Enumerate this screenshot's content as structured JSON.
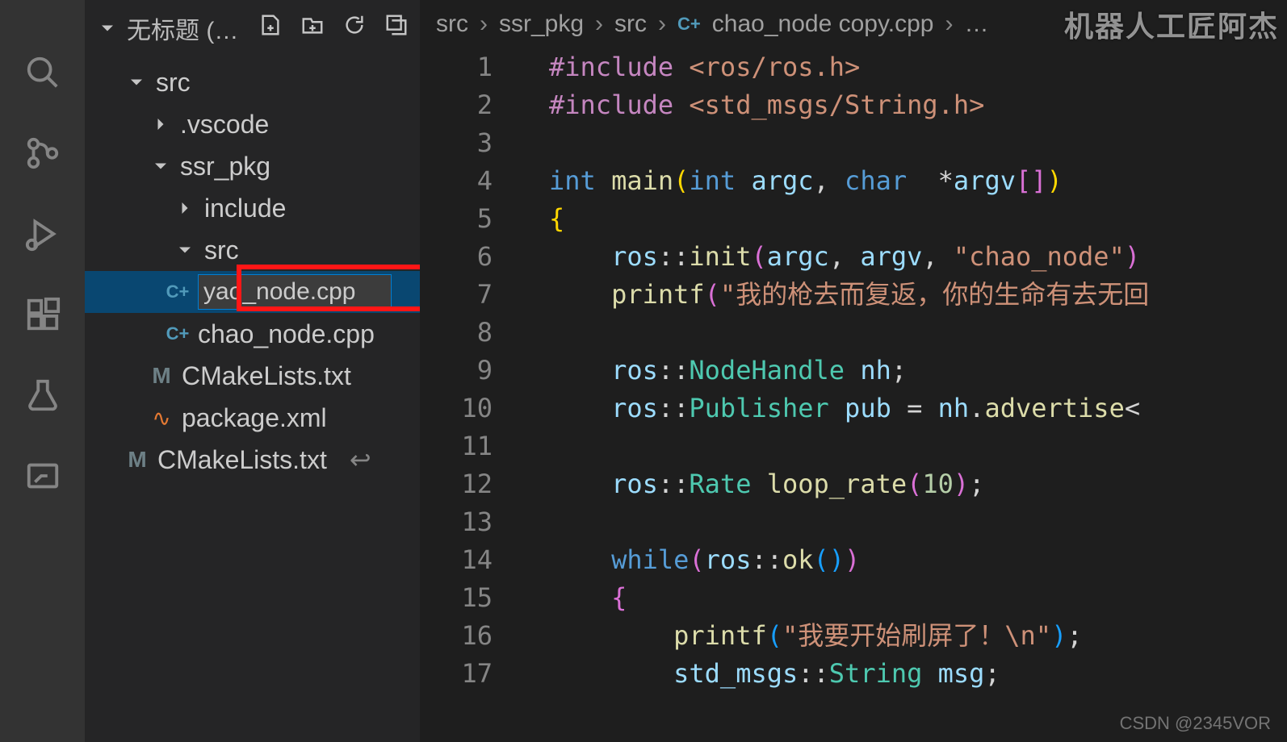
{
  "sidebar": {
    "title": "无标题 (…",
    "tree": {
      "root": "src",
      "items": [
        {
          "label": ".vscode",
          "type": "folder",
          "expanded": false,
          "depth": 1
        },
        {
          "label": "ssr_pkg",
          "type": "folder",
          "expanded": true,
          "depth": 1
        },
        {
          "label": "include",
          "type": "folder",
          "expanded": false,
          "depth": 2
        },
        {
          "label": "src",
          "type": "folder",
          "expanded": true,
          "depth": 2
        },
        {
          "label": "yao_node.cpp",
          "type": "file",
          "icon": "cpp",
          "depth": 3,
          "renaming": true
        },
        {
          "label": "chao_node.cpp",
          "type": "file",
          "icon": "cpp",
          "depth": 3
        },
        {
          "label": "CMakeLists.txt",
          "type": "file",
          "icon": "m",
          "depth": 2
        },
        {
          "label": "package.xml",
          "type": "file",
          "icon": "xml",
          "depth": 2
        },
        {
          "label": "CMakeLists.txt",
          "type": "file",
          "icon": "m",
          "depth": 1,
          "linked": true
        }
      ]
    }
  },
  "breadcrumbs": [
    "src",
    "ssr_pkg",
    "src",
    "chao_node copy.cpp",
    "…"
  ],
  "code": {
    "lines": [
      [
        [
          "pp",
          "#include"
        ],
        [
          "pun",
          " "
        ],
        [
          "inc",
          "<ros/ros.h>"
        ]
      ],
      [
        [
          "pp",
          "#include"
        ],
        [
          "pun",
          " "
        ],
        [
          "inc",
          "<std_msgs/String.h>"
        ]
      ],
      [],
      [
        [
          "kw",
          "int"
        ],
        [
          "pun",
          " "
        ],
        [
          "fn",
          "main"
        ],
        [
          "br1",
          "("
        ],
        [
          "kw",
          "int"
        ],
        [
          "pun",
          " "
        ],
        [
          "var",
          "argc"
        ],
        [
          "pun",
          ", "
        ],
        [
          "kw",
          "char"
        ],
        [
          "pun",
          "  *"
        ],
        [
          "var",
          "argv"
        ],
        [
          "br2",
          "["
        ],
        [
          "br2",
          "]"
        ],
        [
          "br1",
          ")"
        ]
      ],
      [
        [
          "br1",
          "{"
        ]
      ],
      [
        [
          "pun",
          "    "
        ],
        [
          "var",
          "ros"
        ],
        [
          "pun",
          "::"
        ],
        [
          "fn",
          "init"
        ],
        [
          "br2",
          "("
        ],
        [
          "var",
          "argc"
        ],
        [
          "pun",
          ", "
        ],
        [
          "var",
          "argv"
        ],
        [
          "pun",
          ", "
        ],
        [
          "str",
          "\"chao_node\""
        ],
        [
          "br2",
          ")"
        ]
      ],
      [
        [
          "pun",
          "    "
        ],
        [
          "fn",
          "printf"
        ],
        [
          "br2",
          "("
        ],
        [
          "str",
          "\"我的枪去而复返，你的生命有去无回"
        ]
      ],
      [],
      [
        [
          "pun",
          "    "
        ],
        [
          "var",
          "ros"
        ],
        [
          "pun",
          "::"
        ],
        [
          "type",
          "NodeHandle"
        ],
        [
          "pun",
          " "
        ],
        [
          "var",
          "nh"
        ],
        [
          "pun",
          ";"
        ]
      ],
      [
        [
          "pun",
          "    "
        ],
        [
          "var",
          "ros"
        ],
        [
          "pun",
          "::"
        ],
        [
          "type",
          "Publisher"
        ],
        [
          "pun",
          " "
        ],
        [
          "var",
          "pub"
        ],
        [
          "pun",
          " = "
        ],
        [
          "var",
          "nh"
        ],
        [
          "pun",
          "."
        ],
        [
          "fn",
          "advertise"
        ],
        [
          "pun",
          "<"
        ]
      ],
      [],
      [
        [
          "pun",
          "    "
        ],
        [
          "var",
          "ros"
        ],
        [
          "pun",
          "::"
        ],
        [
          "type",
          "Rate"
        ],
        [
          "pun",
          " "
        ],
        [
          "fn",
          "loop_rate"
        ],
        [
          "br2",
          "("
        ],
        [
          "num",
          "10"
        ],
        [
          "br2",
          ")"
        ],
        [
          "pun",
          ";"
        ]
      ],
      [],
      [
        [
          "pun",
          "    "
        ],
        [
          "kw",
          "while"
        ],
        [
          "br2",
          "("
        ],
        [
          "var",
          "ros"
        ],
        [
          "pun",
          "::"
        ],
        [
          "fn",
          "ok"
        ],
        [
          "br3",
          "("
        ],
        [
          "br3",
          ")"
        ],
        [
          "br2",
          ")"
        ]
      ],
      [
        [
          "pun",
          "    "
        ],
        [
          "br2",
          "{"
        ]
      ],
      [
        [
          "pun",
          "        "
        ],
        [
          "fn",
          "printf"
        ],
        [
          "br3",
          "("
        ],
        [
          "str",
          "\"我要开始刷屏了！\\n\""
        ],
        [
          "br3",
          ")"
        ],
        [
          "pun",
          ";"
        ]
      ],
      [
        [
          "pun",
          "        "
        ],
        [
          "var",
          "std_msgs"
        ],
        [
          "pun",
          "::"
        ],
        [
          "type",
          "String"
        ],
        [
          "pun",
          " "
        ],
        [
          "var",
          "msg"
        ],
        [
          "pun",
          ";"
        ]
      ]
    ]
  },
  "watermarks": {
    "top_right": "机器人工匠阿杰",
    "bottom_right": "CSDN @2345VOR"
  }
}
